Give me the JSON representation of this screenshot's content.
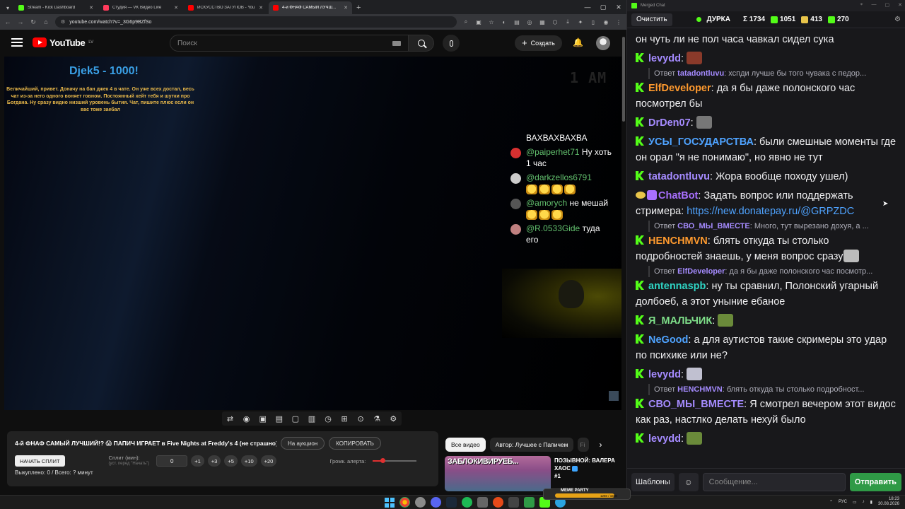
{
  "browser": {
    "tabs": [
      {
        "title": "Stream - Kick Dashboard",
        "color": "#53fc18",
        "active": false
      },
      {
        "title": "Студия — VK Видео Live",
        "color": "#ff3b5c",
        "active": false
      },
      {
        "title": "ИСКУССТВО ЗАТУПОВ - YouTube",
        "color": "#ff0000",
        "active": false
      },
      {
        "title": "4-й ФНАФ САМЫЙ ЛУЧШ...",
        "color": "#ff0000",
        "active": true
      }
    ],
    "url": "youtube.com/watch?v=_3G6p9BZfSo"
  },
  "youtube": {
    "logo_text": "YouTube",
    "region": "LV",
    "search_placeholder": "Поиск",
    "create_label": "Создать"
  },
  "video": {
    "donation_name": "Djek5 - 1000!",
    "donation_text": "Величайший, привет. Доначу на бан джек 4 в чате. Он уже всех достал, весь чат из-за него одного воняет говном. Постоянный хейт тебя и шутки про Богдана. Ну сразу видно низший уровень бытия. Чат, пишите плюс если он вас тоже заебал",
    "timer": "1 AM",
    "chat_head": "ВАХВАХВАХВА",
    "chat_messages": [
      {
        "user": "@paiperhet71",
        "text": "Ну хоть 1 час",
        "avatar": "#d83030"
      },
      {
        "user": "@darkzellos6791",
        "text": "",
        "avatar": "#cccccc"
      },
      {
        "user": "@amorych",
        "text": "не мешай",
        "avatar": "#555555"
      },
      {
        "user": "@R.0533Gide",
        "text": "туда его",
        "avatar": "#c08080"
      }
    ]
  },
  "extension": {
    "title": "4-й ФНАФ САМЫЙ ЛУЧШИЙ!? 😱 ПАПИЧ ИГРАЕТ в Five Nights at Freddy's 4 (не страшно)",
    "auction_label": "На аукцион",
    "copy_label": "КОПИРОВАТЬ",
    "split_button": "НАЧАТЬ СПЛИТ",
    "split_label": "Сплит (мин):",
    "split_hint": "(уст. перед \"Начать\")",
    "split_value": "0",
    "increments": [
      "+1",
      "+3",
      "+5",
      "+10",
      "+20"
    ],
    "volume_label": "Громк. алерта:",
    "volume_level": 0.22,
    "status": "Выкуплено: 0 / Всего: ? минут"
  },
  "related": {
    "chips": [
      "Все видео",
      "Автор: Лучшее с Папичем",
      "Fi"
    ],
    "thumb_text": "ЗАБЛОКИВИРУЕБ...",
    "video_title": "ПОЗЫВНОЙ: ВАЛЕРА ХАОС",
    "video_title_2": "#1"
  },
  "chat": {
    "window_title": "Merged Chat",
    "clear_label": "Очистить",
    "channel": "ДУРКА",
    "stats": [
      {
        "label": "Σ 1734",
        "color": "#ffffff"
      },
      {
        "label": "1051",
        "color": "#53fc18"
      },
      {
        "label": "413",
        "color": "#e8c44a"
      },
      {
        "label": "270",
        "color": "#53fc18"
      }
    ],
    "messages": [
      {
        "user": "",
        "color": "#efeff1",
        "text": "он чуть ли не пол часа чавкал сидел сука",
        "kick": false
      },
      {
        "user": "levydd",
        "color": "#a58bff",
        "text": "",
        "emote": "#8a3a2a",
        "kick": true,
        "reply_user": "tatadontluvu",
        "reply_text": "хспди лучше бы того чувака с педор..."
      },
      {
        "user": "ElfDeveloper",
        "color": "#ff9a2e",
        "text": "да я бы даже полонского час посмотрел бы",
        "kick": true
      },
      {
        "user": "DrDen07",
        "color": "#a58bff",
        "text": "",
        "emote": "#777777",
        "kick": true
      },
      {
        "user": "УСЫ_ГОСУДАРСТВА",
        "color": "#4fa3ff",
        "text": "были смешные моменты где он орал \"я не понимаю\", но явно не тут",
        "kick": true
      },
      {
        "user": "tatadontluvu",
        "color": "#a58bff",
        "text": "Жора вообще походу ушел)",
        "kick": true
      },
      {
        "user": "ChatBot",
        "color": "#a970ff",
        "text": "Задать вопрос или поддержать стримера: ",
        "link": "https://new.donatepay.ru/@GRPZDC",
        "kick": false,
        "bot": true,
        "reply_user": "СВО_МЫ_ВМЕСТЕ",
        "reply_text": "Много, тут вырезано дохуя, а ..."
      },
      {
        "user": "HENCHMVN",
        "color": "#ff9a2e",
        "text": "блять откуда ты столько подробностей знаешь, у меня вопрос сразу",
        "emote": "#bbbbbb",
        "kick": true,
        "reply_user": "ElfDeveloper",
        "reply_text": "да я бы даже полонского час посмотр..."
      },
      {
        "user": "antennaspb",
        "color": "#2fd4c4",
        "text": "ну ты сравнил, Полонский угарный долбоеб, а этот уныние ебаное",
        "kick": true
      },
      {
        "user": "Я_МАЛЬЧИК",
        "color": "#7fe08a",
        "text": "",
        "emote": "#6a8a3a",
        "kick": true
      },
      {
        "user": "NeGood",
        "color": "#4fa3ff",
        "text": "а для аутистов такие скримеры это удар по психике или не?",
        "kick": true
      },
      {
        "user": "levydd",
        "color": "#a58bff",
        "text": "",
        "emote": "#c0c0d0",
        "kick": true,
        "reply_user": "HENCHMVN",
        "reply_text": "блять откуда ты столько подробност..."
      },
      {
        "user": "СВО_МЫ_ВМЕСТЕ",
        "color": "#a58bff",
        "text": "Я смотрел вечером этот видос как раз, настлко делать нехуй было",
        "kick": true
      },
      {
        "user": "levydd",
        "color": "#a58bff",
        "text": "",
        "emote": "#6a8a3a",
        "kick": true
      }
    ],
    "reply_prefix": "Ответ",
    "templates_label": "Шаблоны",
    "input_placeholder": "Сообщение...",
    "send_label": "Отправить"
  },
  "taskbar": {
    "media_label": "MEME PARTY",
    "media_value": "1250 / 1500",
    "lang": "РУС",
    "time": "18:23",
    "date": "30.08.2026"
  }
}
